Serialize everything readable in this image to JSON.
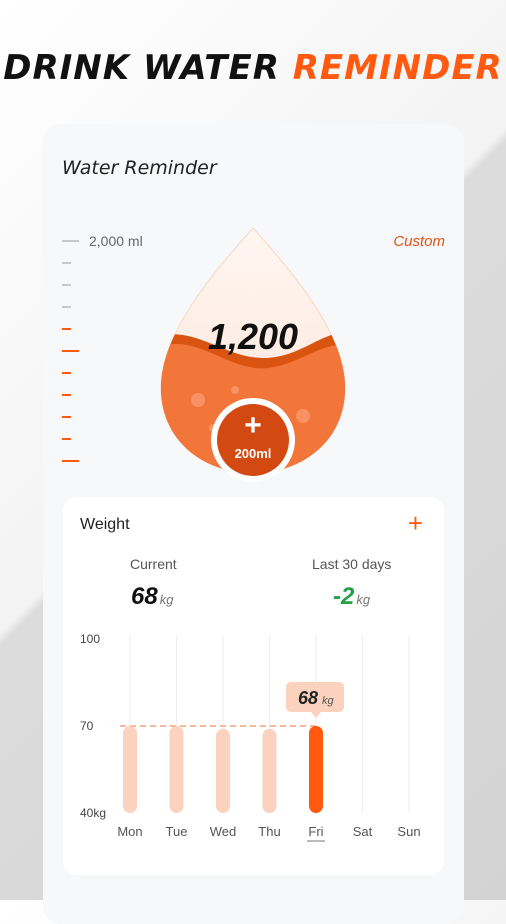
{
  "banner": {
    "part1": "DRINK WATER",
    "part2": "REMINDER"
  },
  "reminder": {
    "title": "Water Reminder",
    "goal_label": "2,000 ml",
    "custom_label": "Custom",
    "current_amount": "1,200",
    "add_plus": "+",
    "add_amount": "200ml",
    "fill_fraction": 0.6
  },
  "weight": {
    "title": "Weight",
    "add_icon": "+",
    "current_label": "Current",
    "current_value": "68",
    "current_unit": "kg",
    "change_label": "Last 30 days",
    "change_value": "-2",
    "change_unit": "kg"
  },
  "colors": {
    "accent": "#ff5a10",
    "accent_dark": "#d24a12",
    "accent_light": "#fbd2bd",
    "green": "#22a046",
    "text_dark": "#111111"
  },
  "chart_data": {
    "type": "bar",
    "categories": [
      "Mon",
      "Tue",
      "Wed",
      "Thu",
      "Fri",
      "Sat",
      "Sun"
    ],
    "values": [
      70,
      70,
      69,
      69,
      70,
      null,
      null
    ],
    "y_ticks": [
      "100",
      "70",
      "40kg"
    ],
    "ylim": [
      40,
      100
    ],
    "highlight_index": 4,
    "highlight_label_value": "68",
    "highlight_label_unit": "kg",
    "reference_value": 70
  }
}
